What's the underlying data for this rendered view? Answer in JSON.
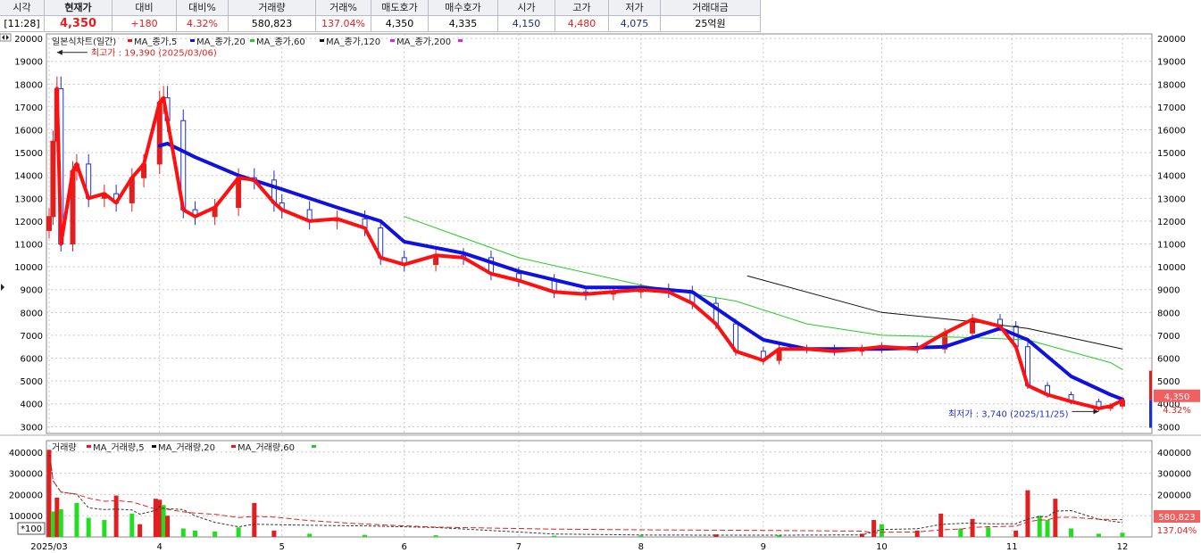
{
  "header": [
    {
      "label": "시각",
      "value": "[11:28]",
      "tone": "black"
    },
    {
      "label": "현재가",
      "value": "4,350",
      "tone": "red",
      "bold": true
    },
    {
      "label": "대비",
      "value": "+180",
      "tone": "red"
    },
    {
      "label": "대비%",
      "value": "4.32%",
      "tone": "red"
    },
    {
      "label": "거래량",
      "value": "580,823",
      "tone": "black"
    },
    {
      "label": "거래%",
      "value": "137.04%",
      "tone": "red"
    },
    {
      "label": "매도호가",
      "value": "4,350",
      "tone": "black"
    },
    {
      "label": "매수호가",
      "value": "4,335",
      "tone": "black"
    },
    {
      "label": "시가",
      "value": "4,150",
      "tone": "navy"
    },
    {
      "label": "고가",
      "value": "4,480",
      "tone": "red"
    },
    {
      "label": "저가",
      "value": "4,075",
      "tone": "navy"
    },
    {
      "label": "거래대금",
      "value": "25억원",
      "tone": "black"
    }
  ],
  "colors": {
    "up": "#e02020",
    "down": "#1d2fd6",
    "ma5": "#ff1010",
    "ma20": "#1010e0",
    "ma60": "#22cc22",
    "ma120": "#111111",
    "ma200": "#e020e0",
    "vol_up": "#e02020",
    "vol_down": "#22dd22"
  },
  "chart_data": {
    "type": "candlestick",
    "title": "일본식차트(일간)",
    "legend": [
      "MA_종가,5",
      "MA_종가,20",
      "MA_종가,60",
      "MA_종가,120",
      "MA_종가,200"
    ],
    "price_axis": {
      "ticks": [
        "20000",
        "19000",
        "18000",
        "17000",
        "16000",
        "15000",
        "14000",
        "13000",
        "12000",
        "11000",
        "10000",
        "9000",
        "8000",
        "7000",
        "6000",
        "5000",
        "4000",
        "3000"
      ],
      "ylim": [
        2700,
        20200
      ]
    },
    "month_labels": [
      "2025/03",
      "4",
      "5",
      "6",
      "7",
      "8",
      "9",
      "10",
      "11",
      "12"
    ],
    "month_tick_dates": [
      "2025-03-04",
      "2025-04-01",
      "2025-05-02",
      "2025-06-02",
      "2025-07-01",
      "2025-08-01",
      "2025-09-01",
      "2025-10-01",
      "2025-11-03",
      "2025-12-01"
    ],
    "grid": true,
    "price_series": [
      {
        "date": "2025-03-04",
        "close": 12200
      },
      {
        "date": "2025-03-05",
        "close": 15500
      },
      {
        "date": "2025-03-06",
        "close": 17800
      },
      {
        "date": "2025-03-07",
        "close": 11000
      },
      {
        "date": "2025-03-10",
        "close": 14200
      },
      {
        "date": "2025-03-11",
        "close": 14500
      },
      {
        "date": "2025-03-14",
        "close": 13000
      },
      {
        "date": "2025-03-18",
        "close": 13200
      },
      {
        "date": "2025-03-21",
        "close": 12800
      },
      {
        "date": "2025-03-25",
        "close": 13900
      },
      {
        "date": "2025-03-28",
        "close": 14500
      },
      {
        "date": "2025-04-01",
        "close": 17200
      },
      {
        "date": "2025-04-02",
        "close": 17400
      },
      {
        "date": "2025-04-03",
        "close": 16400
      },
      {
        "date": "2025-04-07",
        "close": 12500
      },
      {
        "date": "2025-04-10",
        "close": 12200
      },
      {
        "date": "2025-04-15",
        "close": 12600
      },
      {
        "date": "2025-04-21",
        "close": 13900
      },
      {
        "date": "2025-04-25",
        "close": 13800
      },
      {
        "date": "2025-04-30",
        "close": 12800
      },
      {
        "date": "2025-05-02",
        "close": 12500
      },
      {
        "date": "2025-05-09",
        "close": 12000
      },
      {
        "date": "2025-05-16",
        "close": 12100
      },
      {
        "date": "2025-05-23",
        "close": 11700
      },
      {
        "date": "2025-05-27",
        "close": 10400
      },
      {
        "date": "2025-06-02",
        "close": 10100
      },
      {
        "date": "2025-06-10",
        "close": 10500
      },
      {
        "date": "2025-06-17",
        "close": 10400
      },
      {
        "date": "2025-06-24",
        "close": 9700
      },
      {
        "date": "2025-07-01",
        "close": 9400
      },
      {
        "date": "2025-07-10",
        "close": 8900
      },
      {
        "date": "2025-07-18",
        "close": 8800
      },
      {
        "date": "2025-07-25",
        "close": 8900
      },
      {
        "date": "2025-08-01",
        "close": 9000
      },
      {
        "date": "2025-08-08",
        "close": 8900
      },
      {
        "date": "2025-08-14",
        "close": 8400
      },
      {
        "date": "2025-08-20",
        "close": 7500
      },
      {
        "date": "2025-08-25",
        "close": 6300
      },
      {
        "date": "2025-09-01",
        "close": 5900
      },
      {
        "date": "2025-09-05",
        "close": 6400
      },
      {
        "date": "2025-09-12",
        "close": 6400
      },
      {
        "date": "2025-09-19",
        "close": 6300
      },
      {
        "date": "2025-09-26",
        "close": 6400
      },
      {
        "date": "2025-10-01",
        "close": 6500
      },
      {
        "date": "2025-10-10",
        "close": 6400
      },
      {
        "date": "2025-10-17",
        "close": 7100
      },
      {
        "date": "2025-10-24",
        "close": 7700
      },
      {
        "date": "2025-10-31",
        "close": 7400
      },
      {
        "date": "2025-11-04",
        "close": 6500
      },
      {
        "date": "2025-11-07",
        "close": 4800
      },
      {
        "date": "2025-11-12",
        "close": 4400
      },
      {
        "date": "2025-11-18",
        "close": 4100
      },
      {
        "date": "2025-11-25",
        "close": 3800
      },
      {
        "date": "2025-11-28",
        "close": 3900
      },
      {
        "date": "2025-12-01",
        "close": 4150
      }
    ],
    "ma20_series": [
      {
        "date": "2025-04-01",
        "value": 15300
      },
      {
        "date": "2025-04-03",
        "value": 15400
      },
      {
        "date": "2025-04-10",
        "value": 14800
      },
      {
        "date": "2025-04-21",
        "value": 14000
      },
      {
        "date": "2025-05-02",
        "value": 13400
      },
      {
        "date": "2025-05-16",
        "value": 12600
      },
      {
        "date": "2025-05-27",
        "value": 12000
      },
      {
        "date": "2025-06-02",
        "value": 11100
      },
      {
        "date": "2025-06-17",
        "value": 10600
      },
      {
        "date": "2025-07-01",
        "value": 9800
      },
      {
        "date": "2025-07-18",
        "value": 9100
      },
      {
        "date": "2025-08-01",
        "value": 9100
      },
      {
        "date": "2025-08-14",
        "value": 8900
      },
      {
        "date": "2025-08-25",
        "value": 7600
      },
      {
        "date": "2025-09-01",
        "value": 6800
      },
      {
        "date": "2025-09-12",
        "value": 6400
      },
      {
        "date": "2025-10-01",
        "value": 6400
      },
      {
        "date": "2025-10-17",
        "value": 6500
      },
      {
        "date": "2025-10-31",
        "value": 7300
      },
      {
        "date": "2025-11-07",
        "value": 6800
      },
      {
        "date": "2025-11-18",
        "value": 5200
      },
      {
        "date": "2025-11-28",
        "value": 4400
      },
      {
        "date": "2025-12-01",
        "value": 4200
      }
    ],
    "ma60_series": [
      {
        "date": "2025-06-02",
        "value": 12200
      },
      {
        "date": "2025-07-01",
        "value": 10400
      },
      {
        "date": "2025-08-01",
        "value": 9200
      },
      {
        "date": "2025-08-25",
        "value": 8500
      },
      {
        "date": "2025-09-12",
        "value": 7500
      },
      {
        "date": "2025-10-01",
        "value": 7000
      },
      {
        "date": "2025-10-24",
        "value": 6900
      },
      {
        "date": "2025-11-07",
        "value": 6800
      },
      {
        "date": "2025-11-28",
        "value": 5800
      },
      {
        "date": "2025-12-01",
        "value": 5500
      }
    ],
    "ma120_series": [
      {
        "date": "2025-08-28",
        "value": 9600
      },
      {
        "date": "2025-10-01",
        "value": 8000
      },
      {
        "date": "2025-10-24",
        "value": 7600
      },
      {
        "date": "2025-11-07",
        "value": 7300
      },
      {
        "date": "2025-12-01",
        "value": 6400
      }
    ],
    "annotations": {
      "high": {
        "text": "최고가 : 19,390 (2025/03/06)",
        "date": "2025-03-06",
        "value": 19390
      },
      "low": {
        "text": "최저가 : 3,740 (2025/11/25)",
        "date": "2025-11-25",
        "value": 3740
      }
    },
    "current_price": {
      "value": "4,350",
      "change": "4.32%"
    },
    "volume": {
      "title": "거래량",
      "legend": [
        "MA_거래량,5",
        "MA_거래량,20",
        "MA_거래량,60"
      ],
      "ticks": [
        "400000",
        "300000",
        "200000",
        "100000"
      ],
      "ylim": [
        0,
        420000
      ],
      "unit_label": "*100",
      "current": {
        "value": "580,823",
        "ratio": "137.04%"
      },
      "bars": [
        {
          "date": "2025-03-04",
          "value": 410000,
          "up": true
        },
        {
          "date": "2025-03-05",
          "value": 120000,
          "up": false
        },
        {
          "date": "2025-03-06",
          "value": 185000,
          "up": true
        },
        {
          "date": "2025-03-07",
          "value": 130000,
          "up": false
        },
        {
          "date": "2025-03-11",
          "value": 160000,
          "up": false
        },
        {
          "date": "2025-03-14",
          "value": 90000,
          "up": false
        },
        {
          "date": "2025-03-18",
          "value": 80000,
          "up": false
        },
        {
          "date": "2025-03-21",
          "value": 195000,
          "up": true
        },
        {
          "date": "2025-03-25",
          "value": 110000,
          "up": false
        },
        {
          "date": "2025-03-27",
          "value": 60000,
          "up": true
        },
        {
          "date": "2025-03-31",
          "value": 180000,
          "up": true
        },
        {
          "date": "2025-04-01",
          "value": 175000,
          "up": true
        },
        {
          "date": "2025-04-02",
          "value": 150000,
          "up": false
        },
        {
          "date": "2025-04-03",
          "value": 100000,
          "up": true
        },
        {
          "date": "2025-04-07",
          "value": 40000,
          "up": false
        },
        {
          "date": "2025-04-10",
          "value": 30000,
          "up": false
        },
        {
          "date": "2025-04-15",
          "value": 25000,
          "up": false
        },
        {
          "date": "2025-04-21",
          "value": 45000,
          "up": false
        },
        {
          "date": "2025-04-25",
          "value": 160000,
          "up": true
        },
        {
          "date": "2025-04-30",
          "value": 30000,
          "up": true
        },
        {
          "date": "2025-05-09",
          "value": 15000,
          "up": false
        },
        {
          "date": "2025-05-23",
          "value": 10000,
          "up": false
        },
        {
          "date": "2025-06-10",
          "value": 8000,
          "up": false
        },
        {
          "date": "2025-07-10",
          "value": 6000,
          "up": false
        },
        {
          "date": "2025-08-01",
          "value": 7000,
          "up": false
        },
        {
          "date": "2025-08-20",
          "value": 12000,
          "up": true
        },
        {
          "date": "2025-09-05",
          "value": 8000,
          "up": false
        },
        {
          "date": "2025-09-26",
          "value": 15000,
          "up": true
        },
        {
          "date": "2025-09-29",
          "value": 80000,
          "up": true
        },
        {
          "date": "2025-10-01",
          "value": 60000,
          "up": false
        },
        {
          "date": "2025-10-10",
          "value": 30000,
          "up": true
        },
        {
          "date": "2025-10-16",
          "value": 110000,
          "up": true
        },
        {
          "date": "2025-10-21",
          "value": 40000,
          "up": false
        },
        {
          "date": "2025-10-24",
          "value": 85000,
          "up": true
        },
        {
          "date": "2025-10-28",
          "value": 45000,
          "up": false
        },
        {
          "date": "2025-11-04",
          "value": 30000,
          "up": true
        },
        {
          "date": "2025-11-07",
          "value": 220000,
          "up": true
        },
        {
          "date": "2025-11-10",
          "value": 100000,
          "up": false
        },
        {
          "date": "2025-11-12",
          "value": 80000,
          "up": false
        },
        {
          "date": "2025-11-14",
          "value": 180000,
          "up": true
        },
        {
          "date": "2025-11-18",
          "value": 40000,
          "up": false
        },
        {
          "date": "2025-11-25",
          "value": 15000,
          "up": false
        },
        {
          "date": "2025-12-01",
          "value": 20000,
          "up": false
        }
      ]
    }
  }
}
